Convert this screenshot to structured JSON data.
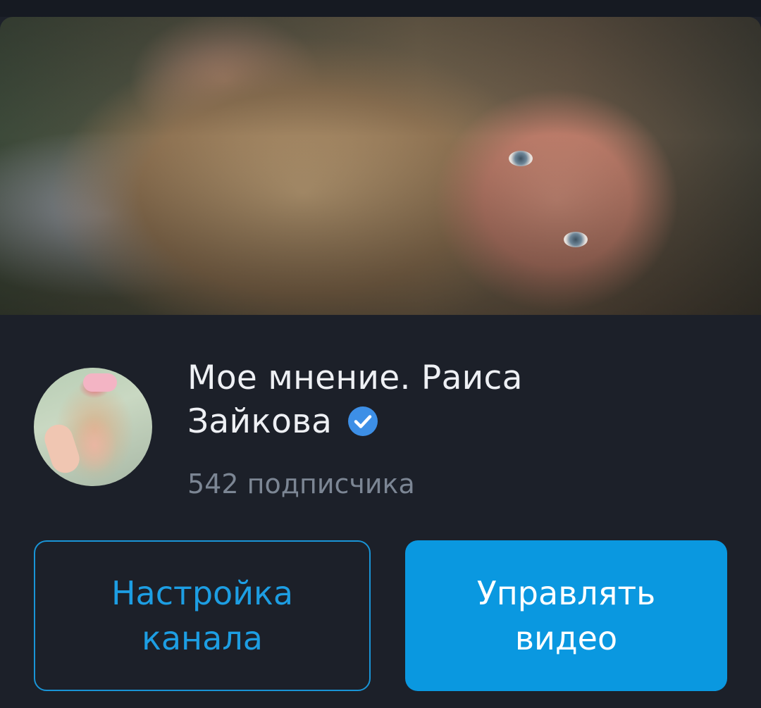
{
  "channel": {
    "title_line1": "Мое мнение. Раиса",
    "title_line2": "Зайкова",
    "subscribers": "542 подписчика",
    "verified": true
  },
  "buttons": {
    "settings_line1": "Настройка",
    "settings_line2": "канала",
    "manage_line1": "Управлять",
    "manage_line2": "видео"
  },
  "colors": {
    "background": "#1c2029",
    "accent": "#0a98e0",
    "verified_badge": "#3d8fe6"
  },
  "icons": {
    "verified": "verified-check-icon"
  }
}
